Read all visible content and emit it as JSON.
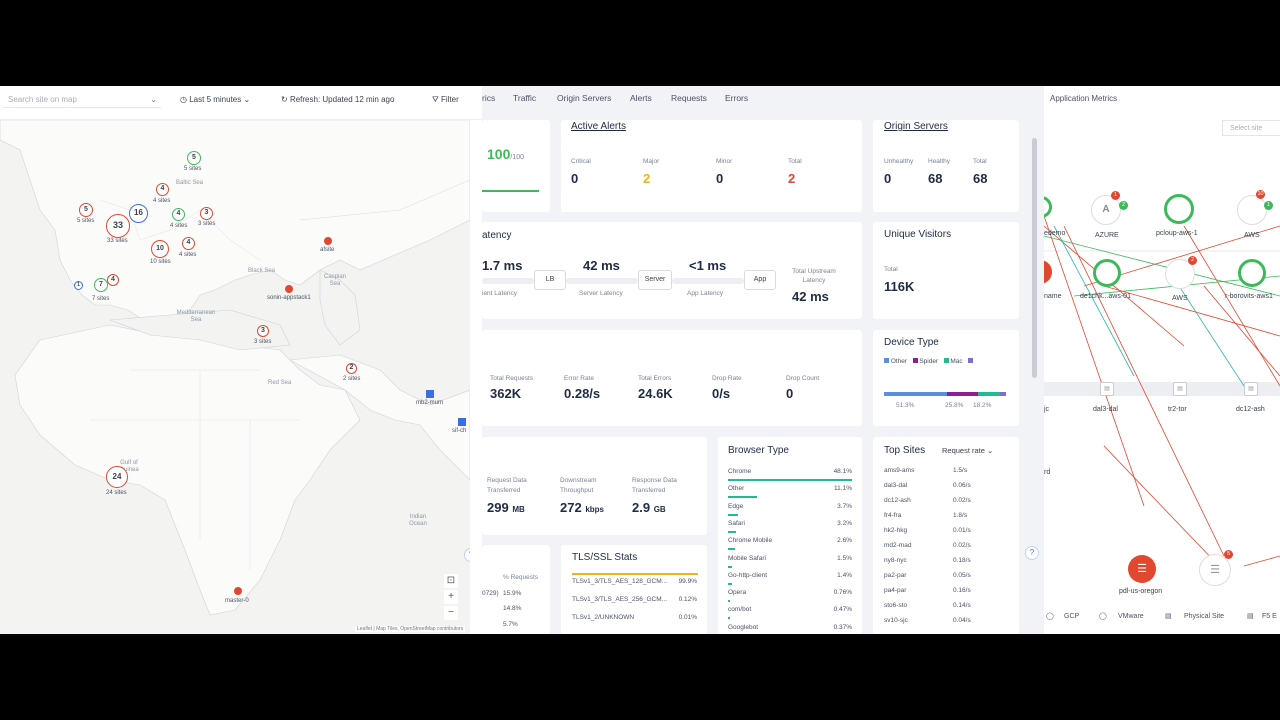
{
  "map_toolbar": {
    "search_placeholder": "Search site on map",
    "time_range": "Last 5 minutes",
    "refresh": "Refresh: Updated 12 min ago",
    "filter": "Filter"
  },
  "map": {
    "clusters": [
      {
        "count": "5",
        "label": "5 sites",
        "color": "green"
      },
      {
        "count": "4",
        "label": "4 sites",
        "color": "red"
      },
      {
        "count": "5",
        "label": "5 sites",
        "color": "red"
      },
      {
        "count": "33",
        "label": "33 sites",
        "color": "red"
      },
      {
        "count": "16",
        "label": "",
        "color": "blue"
      },
      {
        "count": "4",
        "label": "4 sites",
        "color": "green"
      },
      {
        "count": "3",
        "label": "3 sites",
        "color": "red"
      },
      {
        "count": "10",
        "label": "10 sites",
        "color": "red"
      },
      {
        "count": "4",
        "label": "4 sites",
        "color": "red"
      },
      {
        "count": "7",
        "label": "7 sites",
        "color": "green"
      },
      {
        "count": "1",
        "label": "",
        "color": "blue"
      },
      {
        "count": "4",
        "label": "",
        "color": "red"
      },
      {
        "count": "3",
        "label": "3 sites",
        "color": "red"
      },
      {
        "count": "2",
        "label": "2 sites",
        "color": "red"
      },
      {
        "count": "24",
        "label": "24 sites",
        "color": "red"
      }
    ],
    "sites": [
      "afsite",
      "sonin-appstack1",
      "mb2-mum",
      "sif-ch",
      "master-0"
    ],
    "seas": [
      "Baltic Sea",
      "Black Sea",
      "Caspian Sea",
      "Mediterranean Sea",
      "Red Sea",
      "Gulf of Guinea",
      "Indian Ocean"
    ],
    "attribution": "Leaflet | Map Tiles, OpenStreetMap contributors"
  },
  "dash": {
    "tabs": [
      "rics",
      "Traffic",
      "Origin Servers",
      "Alerts",
      "Requests",
      "Errors"
    ],
    "health": {
      "value": "100",
      "suffix": "/100"
    },
    "alerts": {
      "title": "Active Alerts",
      "critical_l": "Critical",
      "critical": "0",
      "major_l": "Major",
      "major": "2",
      "minor_l": "Minor",
      "minor": "0",
      "total_l": "Total",
      "total": "2"
    },
    "origin": {
      "title": "Origin Servers",
      "unhealthy_l": "Unhealthy",
      "unhealthy": "0",
      "healthy_l": "Healthy",
      "healthy": "68",
      "total_l": "Total",
      "total": "68"
    },
    "latency": {
      "title": "atency",
      "client": "1.7 ms",
      "client_l": "ient Latency",
      "lb": "LB",
      "server": "42 ms",
      "server_l": "Server Latency",
      "server_node": "Server",
      "app": "<1 ms",
      "app_l": "App Latency",
      "app_node": "App",
      "upstream_l": "Total Upstream Latency",
      "upstream": "42 ms"
    },
    "visitors": {
      "title": "Unique Visitors",
      "total_l": "Total",
      "total": "116K"
    },
    "requests": {
      "total_l": "Total Requests",
      "total": "362K",
      "err_l": "Error Rate",
      "err": "0.28/s",
      "terr_l": "Total Errors",
      "terr": "24.6K",
      "drop_l": "Drop Rate",
      "drop": "0/s",
      "dcount_l": "Drop Count",
      "dcount": "0"
    },
    "device": {
      "title": "Device Type",
      "legend": [
        "Other",
        "Spider",
        "Mac",
        ""
      ],
      "pcts": [
        "51.3%",
        "25.8%",
        "18.2%"
      ],
      "colors": [
        "#5b8fde",
        "#8b1f8f",
        "#27b98e",
        "#7b6fd0"
      ],
      "shares": [
        0.513,
        0.258,
        0.182,
        0.047
      ]
    },
    "transfer": {
      "req_l": "Request Data Transferred",
      "req": "299",
      "req_u": "MB",
      "down_l": "Downstream Throughput",
      "down": "272",
      "down_u": "kbps",
      "resp_l": "Response Data Transferred",
      "resp": "2.9",
      "resp_u": "GB"
    },
    "browser": {
      "title": "Browser Type",
      "items": [
        {
          "n": "Chrome",
          "v": "48.1%",
          "s": 48.1
        },
        {
          "n": "Other",
          "v": "11.1%",
          "s": 11.1
        },
        {
          "n": "Edge",
          "v": "3.7%",
          "s": 3.7
        },
        {
          "n": "Safari",
          "v": "3.2%",
          "s": 3.2
        },
        {
          "n": "Chrome Mobile",
          "v": "2.6%",
          "s": 2.6
        },
        {
          "n": "Mobile Safari",
          "v": "1.5%",
          "s": 1.5
        },
        {
          "n": "Go-http-client",
          "v": "1.4%",
          "s": 1.4
        },
        {
          "n": "Opera",
          "v": "0.76%",
          "s": 0.76
        },
        {
          "n": "com/bot",
          "v": "0.47%",
          "s": 0.47
        },
        {
          "n": "Googlebot",
          "v": "0.37%",
          "s": 0.37
        }
      ]
    },
    "topsites": {
      "title": "Top Sites",
      "metric": "Request rate",
      "items": [
        {
          "n": "ams9-ams",
          "v": "1.5/s"
        },
        {
          "n": "dal3-dal",
          "v": "0.06/s"
        },
        {
          "n": "dc12-ash",
          "v": "0.02/s"
        },
        {
          "n": "fr4-fra",
          "v": "1.8/s"
        },
        {
          "n": "hk2-hkg",
          "v": "0.01/s"
        },
        {
          "n": "md2-mad",
          "v": "0.02/s"
        },
        {
          "n": "ny8-nyc",
          "v": "0.18/s"
        },
        {
          "n": "pa2-par",
          "v": "0.05/s"
        },
        {
          "n": "pa4-par",
          "v": "0.16/s"
        },
        {
          "n": "sto6-sto",
          "v": "0.14/s"
        },
        {
          "n": "sv10-sjc",
          "v": "0.04/s"
        }
      ]
    },
    "tls": {
      "title": "TLS/SSL Stats",
      "items": [
        {
          "n": "TLSv1_3/TLS_AES_128_GCM...",
          "v": "99.9%"
        },
        {
          "n": "TLSv1_3/TLS_AES_256_GCM...",
          "v": "0.12%"
        },
        {
          "n": "TLSv1_2/UNKNOWN",
          "v": "0.01%"
        }
      ]
    },
    "partial": {
      "col": "% Requests",
      "rows": [
        {
          "n": "0729)",
          "v": "15.9%"
        },
        {
          "n": "",
          "v": "14.8%"
        },
        {
          "n": "",
          "v": "5.7%"
        }
      ]
    }
  },
  "topo": {
    "title": "Application Metrics",
    "select": "Select site",
    "nodes": [
      "edemo",
      "AZURE",
      "pcloup-aws-1",
      "AWS",
      "name",
      "de1chk...aws-01",
      "AWS",
      "r-borovits-aws1",
      "dal3-dal",
      "tr2-tor",
      "dc12-ash",
      "pdl-us-oregon",
      "jc",
      "rd"
    ],
    "badges": [
      "1",
      "2",
      "2",
      "10",
      "1",
      "5"
    ],
    "legend": [
      "GCP",
      "VMware",
      "Physical Site",
      "F5 E"
    ]
  }
}
